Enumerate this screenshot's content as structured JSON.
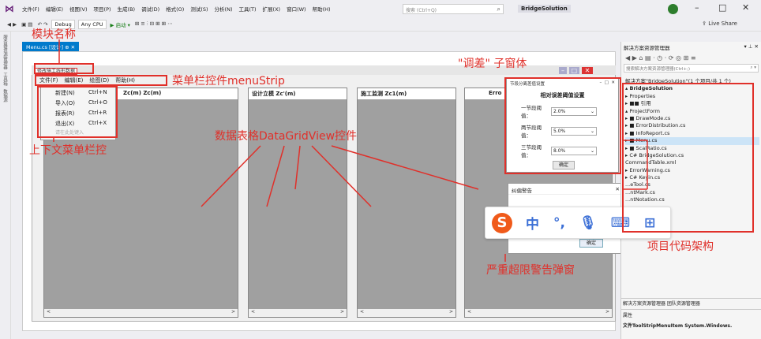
{
  "menubar": {
    "items": [
      "文件(F)",
      "编辑(E)",
      "视图(V)",
      "项目(P)",
      "生成(B)",
      "调试(D)",
      "格式(O)",
      "测试(S)",
      "分析(N)",
      "工具(T)",
      "扩展(X)",
      "窗口(W)",
      "帮助(H)"
    ],
    "search_placeholder": "搜索 (Ctrl+Q)",
    "solution_name": "BridgeSolution",
    "minimize": "–",
    "maximize": "□",
    "close": "✕"
  },
  "toolbar": {
    "config": "Debug",
    "platform": "Any CPU",
    "start": "▶ 启动 ▾",
    "live_share": "Live Share"
  },
  "left_tabs": [
    "服务器资源管理器",
    "工具箱",
    "数据源"
  ],
  "doc_tab": "Menu.cs [设计] ⊕ ✕",
  "form": {
    "title": "修改施工线形数据",
    "menu": [
      "文件(F)",
      "编辑(E)",
      "绘图(D)",
      "帮助(H)"
    ],
    "grids": [
      {
        "header": "Zc(m)        Zc(m)"
      },
      {
        "header": "设计立模 Zc'(m)"
      },
      {
        "header": "施工监测 Zc1(m)"
      },
      {
        "header": "Erro"
      }
    ],
    "context_menu": [
      {
        "label": "新建(N)",
        "shortcut": "Ctrl+N"
      },
      {
        "label": "导入(O)",
        "shortcut": "Ctrl+O"
      },
      {
        "label": "报表(R)",
        "shortcut": "Ctrl+R"
      },
      {
        "label": "退出(X)",
        "shortcut": "Ctrl+X"
      }
    ],
    "context_add": "请在此处键入"
  },
  "dialog": {
    "title": "节段分离差值设置",
    "heading": "相对误差阈值设置",
    "rows": [
      {
        "label": "一节段阈值：",
        "value": "2.0%"
      },
      {
        "label": "两节段阈值：",
        "value": "5.0%"
      },
      {
        "label": "三节段阈值：",
        "value": "8.0%"
      }
    ],
    "ok": "确定"
  },
  "warning": {
    "title": "纠偏警告",
    "close": "✕",
    "ok": "确定"
  },
  "ime": {
    "logo": "S",
    "items": [
      "中",
      "°,",
      "🎙",
      "⌨",
      "⊞"
    ]
  },
  "annotations": {
    "module_name": "模块名称",
    "menustrip": "菜单栏控件menuStrip",
    "sub_window": "\"调差\" 子窗体",
    "context_menu": "上下文菜单栏控",
    "datagrid": "数据表格DataGridView控件",
    "project_code": "项目代码架构",
    "warning_popup": "严重超限警告弹窗"
  },
  "solution_explorer": {
    "title": "解决方案资源管理器",
    "search_placeholder": "搜索解决方案资源管理器(Ctrl+;)",
    "tree": [
      "解决方案\"BridgeSolution\"(1 个项目/共 1 个)",
      "▴ BridgeSolution",
      "  ▸ Properties",
      "  ▸ ■■ 引用",
      "  ▴ ProjectForm",
      "    ▸ ■ DrawMode.cs",
      "    ▸ ■ ErrorDistribution.cs",
      "    ▸ ■ InfoReport.cs",
      "    ▸ ■ Menu.cs",
      "    ▸ ■ ScalRatio.cs",
      "  ▸ C# BridgeSolution.cs",
      "    CommandTable.xml",
      "  ▸ ErrorWarning.cs",
      "  ▸ C# Keyin.cs",
      "    ...eTool.cs",
      "    ...ntMark.cs",
      "    ...ntNotation.cs"
    ],
    "bottom_tabs": "解决方案资源管理器  团队资源管理器",
    "props_title": "属性",
    "props_value": "文件ToolStripMenuItem  System.Windows."
  },
  "colors": {
    "annotation": "#e0302a",
    "accent": "#007acc"
  }
}
